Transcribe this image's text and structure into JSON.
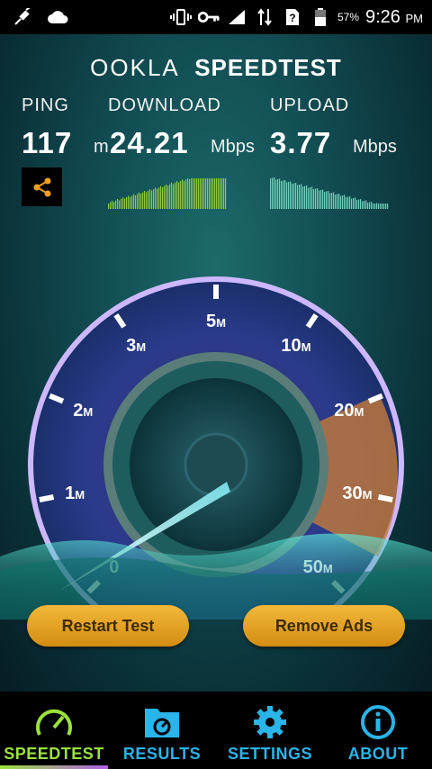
{
  "status_bar": {
    "battery_percent": "57%",
    "time": "9:26",
    "ampm": "PM"
  },
  "app": {
    "logo_text": "OOKLA",
    "logo_text2": "SPEEDTEST"
  },
  "metrics": {
    "ping": {
      "label": "PING",
      "value": "117",
      "unit": "m"
    },
    "download": {
      "label": "DOWNLOAD",
      "value": "24.21",
      "unit": "Mbps"
    },
    "upload": {
      "label": "UPLOAD",
      "value": "3.77",
      "unit": "Mbps"
    }
  },
  "gauge": {
    "ticks": [
      {
        "label": "0",
        "suffix": ""
      },
      {
        "label": "1",
        "suffix": "M"
      },
      {
        "label": "2",
        "suffix": "M"
      },
      {
        "label": "3",
        "suffix": "M"
      },
      {
        "label": "5",
        "suffix": "M"
      },
      {
        "label": "10",
        "suffix": "M"
      },
      {
        "label": "20",
        "suffix": "M"
      },
      {
        "label": "30",
        "suffix": "M"
      },
      {
        "label": "50",
        "suffix": "M"
      }
    ]
  },
  "buttons": {
    "restart": "Restart Test",
    "remove_ads": "Remove Ads"
  },
  "nav": {
    "items": [
      {
        "label": "SPEEDTEST",
        "color": "#9be23a"
      },
      {
        "label": "RESULTS",
        "color": "#2ab4e8"
      },
      {
        "label": "SETTINGS",
        "color": "#2ab4e8"
      },
      {
        "label": "ABOUT",
        "color": "#2ab4e8"
      }
    ]
  },
  "colors": {
    "accent_gold": "#e6a521",
    "active_tab": "#9be23a",
    "inactive_tab": "#2ab4e8",
    "gauge_highlight": "#d98a3a"
  }
}
